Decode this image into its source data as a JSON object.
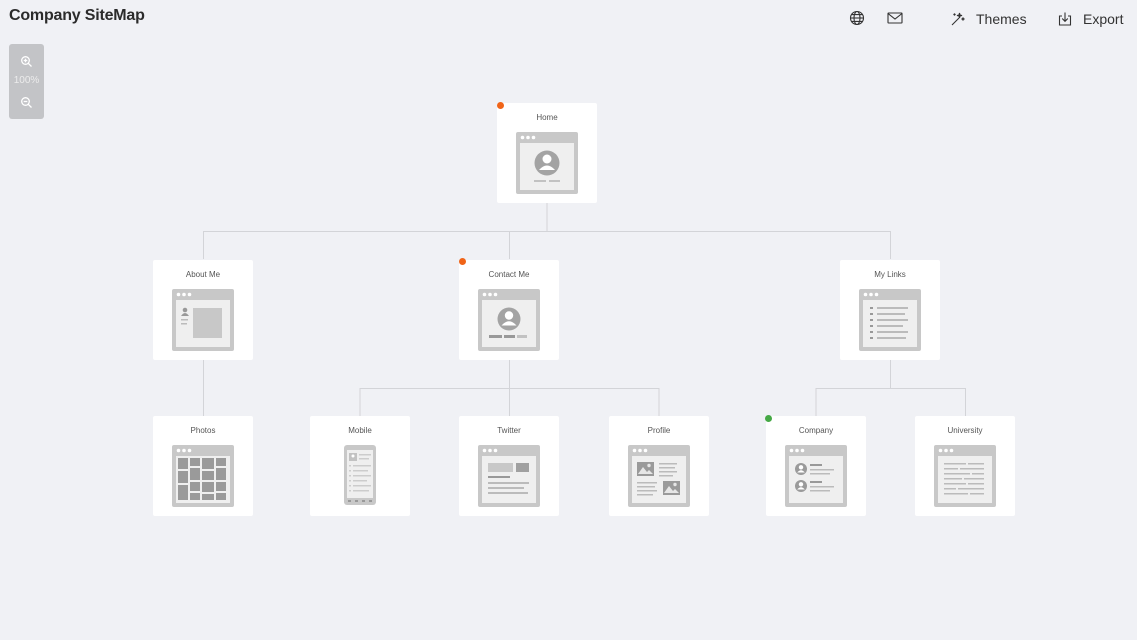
{
  "app": {
    "title": "Company SiteMap"
  },
  "toolbar": {
    "globe_icon": "globe-icon",
    "mail_icon": "mail-icon",
    "themes_label": "Themes",
    "export_label": "Export"
  },
  "zoom": {
    "level": "100%"
  },
  "colors": {
    "background": "#f0f1f5",
    "link": "#d3d4d8",
    "status_orange": "#f06418",
    "status_green": "#45a845"
  },
  "nodes": {
    "home": {
      "label": "Home",
      "status": "orange"
    },
    "about_me": {
      "label": "About Me"
    },
    "contact_me": {
      "label": "Contact Me",
      "status": "orange"
    },
    "my_links": {
      "label": "My Links"
    },
    "photos": {
      "label": "Photos"
    },
    "mobile": {
      "label": "Mobile"
    },
    "twitter": {
      "label": "Twitter"
    },
    "profile": {
      "label": "Profile"
    },
    "company": {
      "label": "Company",
      "status": "green"
    },
    "university": {
      "label": "University"
    }
  }
}
